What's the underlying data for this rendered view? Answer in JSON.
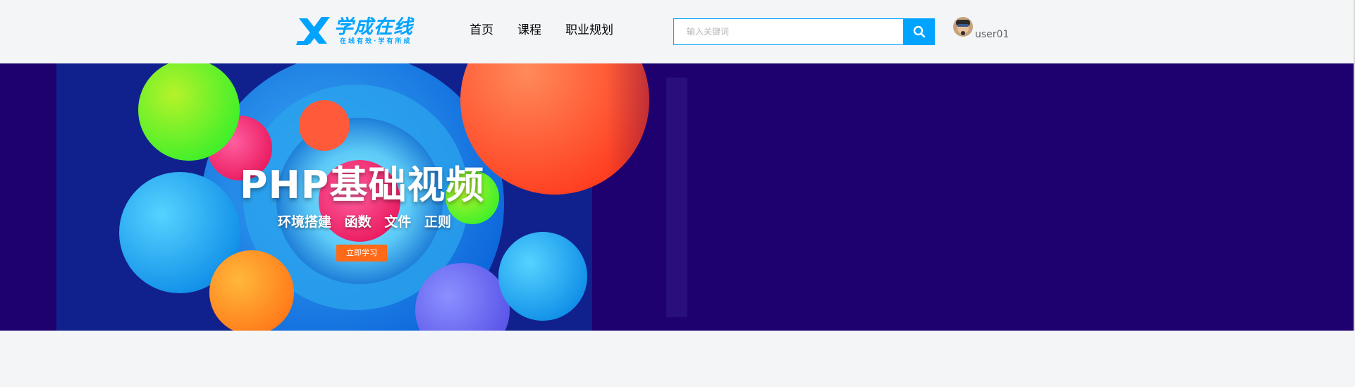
{
  "header": {
    "logo": {
      "title": "学成在线",
      "subtitle": "在线有效·学有所成"
    },
    "nav": [
      {
        "label": "首页"
      },
      {
        "label": "课程"
      },
      {
        "label": "职业规划"
      }
    ],
    "search": {
      "placeholder": "输入关键词",
      "value": "",
      "icon": "search-icon"
    },
    "user": {
      "name": "user01",
      "avatar": "avatar"
    }
  },
  "banner": {
    "title": "PHP基础视频",
    "subtitle": "环境搭建 函数 文件 正则",
    "button_label": "立即学习"
  },
  "colors": {
    "brand": "#00a4ff",
    "banner_bg": "#1e006e",
    "button": "#ff6a18",
    "page_bg": "#f3f5f7"
  }
}
